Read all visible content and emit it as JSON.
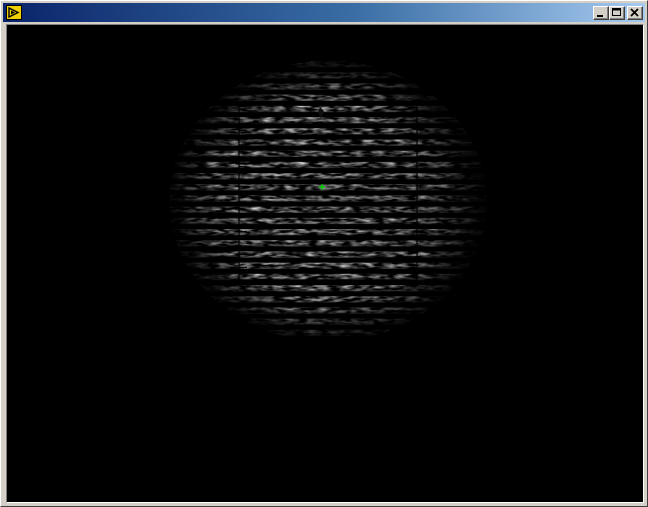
{
  "window": {
    "title": "",
    "icon": "labview-run-arrow-icon",
    "controls": [
      "minimize-icon",
      "maximize-icon",
      "close-icon"
    ]
  },
  "image_view": {
    "content": "interferogram-fringe-spot",
    "roi_rectangle_color": "#000000",
    "center_marker_color": "#00c800",
    "fringe_color": "#e8e8e8",
    "background_color": "#000000"
  }
}
